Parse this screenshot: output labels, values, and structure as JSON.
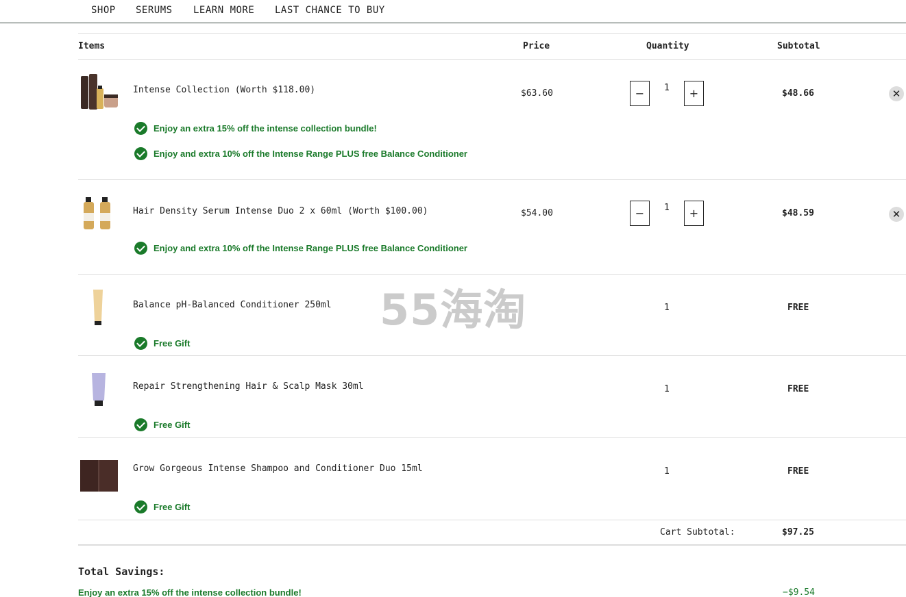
{
  "nav": [
    "SHOP",
    "SERUMS",
    "LEARN MORE",
    "LAST CHANCE TO BUY"
  ],
  "headers": {
    "items": "Items",
    "price": "Price",
    "quantity": "Quantity",
    "subtotal": "Subtotal"
  },
  "items": [
    {
      "name": "Intense Collection (Worth $118.00)",
      "price": "$63.60",
      "qty": "1",
      "subtotal": "$48.66",
      "promos": [
        "Enjoy an extra 15% off the intense collection bundle!",
        "Enjoy and extra 10% off the Intense Range PLUS free Balance Conditioner"
      ]
    },
    {
      "name": "Hair Density Serum Intense Duo 2 x 60ml (Worth $100.00)",
      "price": "$54.00",
      "qty": "1",
      "subtotal": "$48.59",
      "promos": [
        "Enjoy and extra 10% off the Intense Range PLUS free Balance Conditioner"
      ]
    },
    {
      "name": "Balance pH-Balanced Conditioner 250ml",
      "qty": "1",
      "subtotal": "FREE",
      "promos": [
        "Free Gift"
      ]
    },
    {
      "name": "Repair Strengthening Hair & Scalp Mask 30ml",
      "qty": "1",
      "subtotal": "FREE",
      "promos": [
        "Free Gift"
      ]
    },
    {
      "name": "Grow Gorgeous Intense Shampoo and Conditioner Duo 15ml",
      "qty": "1",
      "subtotal": "FREE",
      "promos": [
        "Free Gift"
      ]
    }
  ],
  "qty_controls": {
    "minus": "−",
    "plus": "+"
  },
  "remove_glyph": "✕",
  "cart_subtotal_label": "Cart Subtotal:",
  "cart_subtotal_value": "$97.25",
  "savings_title": "Total Savings:",
  "savings": [
    {
      "label": "Enjoy an extra 15% off the intense collection bundle!",
      "value": "−$9.54"
    }
  ],
  "watermark": "55海淘",
  "colors": {
    "promo_green": "#1a7a2a",
    "border": "#dddddd"
  }
}
